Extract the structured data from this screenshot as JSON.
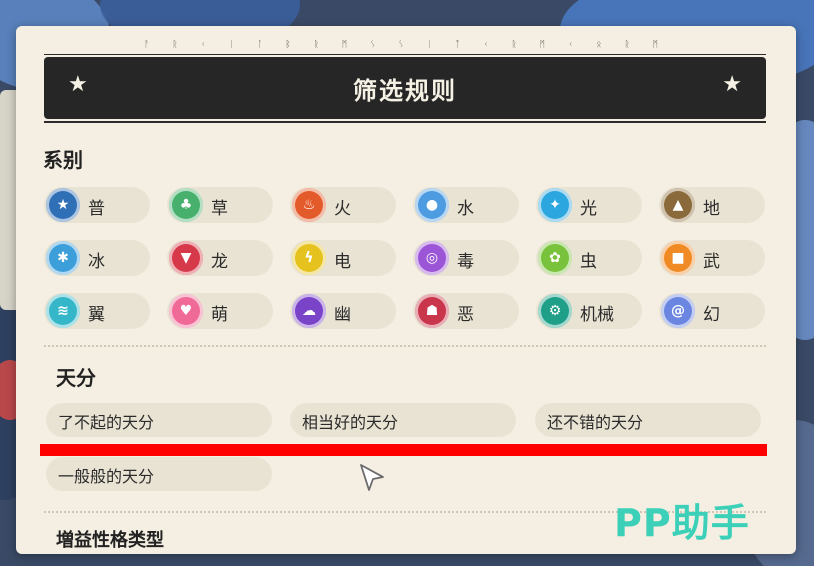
{
  "header": {
    "rune_text": "ᚨ ᚱ ᚲ ᛁ ᛚ  ᛒ ᚱ ᛗ ᛊ ᛊ ᛁ ᛏ ᚲ  ᚱ ᛗ ᚲ ᛟ ᚱ ᛗ",
    "title": "筛选规则"
  },
  "types": {
    "title": "系别",
    "items": [
      {
        "label": "普",
        "icon": "normal-icon",
        "color": "#2f6fb6"
      },
      {
        "label": "草",
        "icon": "leaf-icon",
        "color": "#47b06c"
      },
      {
        "label": "火",
        "icon": "flame-icon",
        "color": "#e45b2b"
      },
      {
        "label": "水",
        "icon": "water-drop-icon",
        "color": "#4d9be0"
      },
      {
        "label": "光",
        "icon": "sparkle-icon",
        "color": "#2ca6de"
      },
      {
        "label": "地",
        "icon": "mountain-icon",
        "color": "#8a6a3a"
      },
      {
        "label": "冰",
        "icon": "snowflake-icon",
        "color": "#3d9fd9"
      },
      {
        "label": "龙",
        "icon": "dragon-icon",
        "color": "#d63a4a"
      },
      {
        "label": "电",
        "icon": "lightning-icon",
        "color": "#e6c21f"
      },
      {
        "label": "毒",
        "icon": "poison-icon",
        "color": "#9b55d6"
      },
      {
        "label": "虫",
        "icon": "bug-icon",
        "color": "#79c23c"
      },
      {
        "label": "武",
        "icon": "fist-icon",
        "color": "#f08a24"
      },
      {
        "label": "翼",
        "icon": "wing-icon",
        "color": "#36b7c9"
      },
      {
        "label": "萌",
        "icon": "heart-icon",
        "color": "#ef6a96"
      },
      {
        "label": "幽",
        "icon": "ghost-icon",
        "color": "#7a44c9"
      },
      {
        "label": "恶",
        "icon": "demon-icon",
        "color": "#c9354a"
      },
      {
        "label": "机械",
        "icon": "gear-icon",
        "color": "#1f9e88"
      },
      {
        "label": "幻",
        "icon": "spiral-icon",
        "color": "#6b86e0"
      }
    ]
  },
  "talent": {
    "title": "天分",
    "items": [
      "了不起的天分",
      "相当好的天分",
      "还不错的天分",
      "一般般的天分"
    ]
  },
  "next_section_partial": "増益性格类型",
  "watermark": "PP助手",
  "colors": {
    "highlight_bar": "#ff0000",
    "panel_bg": "#f4efe2",
    "title_bg": "#262626"
  }
}
